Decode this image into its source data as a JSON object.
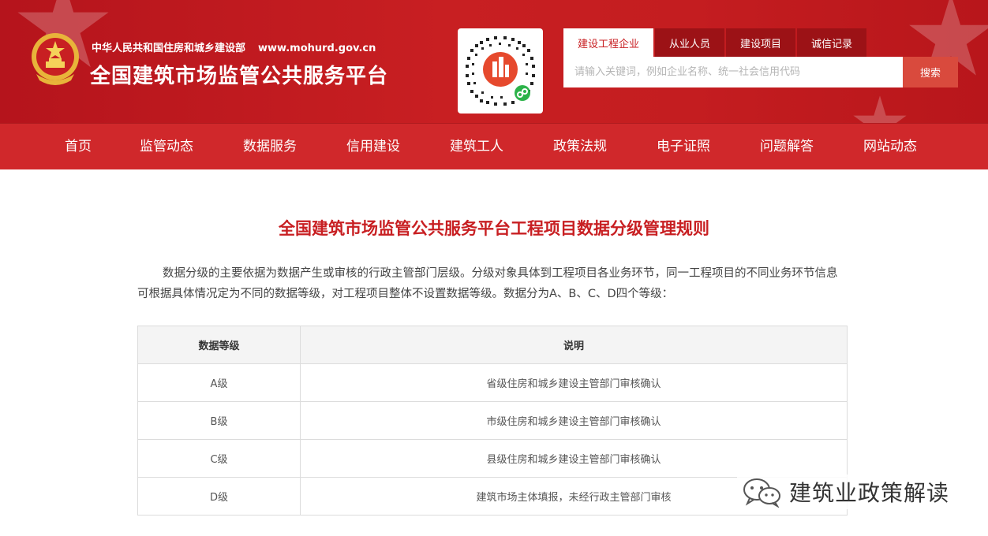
{
  "header": {
    "ministry_name": "中华人民共和国住房和城乡建设部",
    "ministry_url": "www.mohurd.gov.cn",
    "platform_name": "全国建筑市场监管公共服务平台",
    "qr_icon": "mini-program-qr-icon"
  },
  "search": {
    "tabs": [
      {
        "label": "建设工程企业",
        "active": true
      },
      {
        "label": "从业人员",
        "active": false
      },
      {
        "label": "建设项目",
        "active": false
      },
      {
        "label": "诚信记录",
        "active": false
      }
    ],
    "placeholder": "请输入关键词，例如企业名称、统一社会信用代码",
    "button_label": "搜索"
  },
  "nav": {
    "items": [
      {
        "label": "首页"
      },
      {
        "label": "监管动态"
      },
      {
        "label": "数据服务"
      },
      {
        "label": "信用建设"
      },
      {
        "label": "建筑工人"
      },
      {
        "label": "政策法规"
      },
      {
        "label": "电子证照"
      },
      {
        "label": "问题解答"
      },
      {
        "label": "网站动态"
      }
    ]
  },
  "content": {
    "title": "全国建筑市场监管公共服务平台工程项目数据分级管理规则",
    "intro": "数据分级的主要依据为数据产生或审核的行政主管部门层级。分级对象具体到工程项目各业务环节，同一工程项目的不同业务环节信息可根据具体情况定为不同的数据等级，对工程项目整体不设置数据等级。数据分为A、B、C、D四个等级：",
    "table": {
      "headers": [
        "数据等级",
        "说明"
      ],
      "rows": [
        [
          "A级",
          "省级住房和城乡建设主管部门审核确认"
        ],
        [
          "B级",
          "市级住房和城乡建设主管部门审核确认"
        ],
        [
          "C级",
          "县级住房和城乡建设主管部门审核确认"
        ],
        [
          "D级",
          "建筑市场主体填报，未经行政主管部门审核"
        ]
      ]
    }
  },
  "watermark": {
    "text": "建筑业政策解读",
    "icon": "wechat-icon"
  },
  "colors": {
    "brand_red": "#c81f22",
    "nav_red": "#d0282b",
    "search_button": "#d94a3d"
  }
}
